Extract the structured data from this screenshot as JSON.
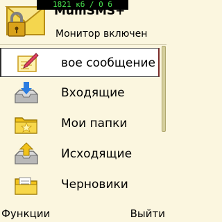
{
  "status_bar": {
    "memory_text": "1821 кб / 0 б"
  },
  "header": {
    "app_title": "MumSMS+",
    "status_text": "Монитор включен",
    "icon": "envelope-lock-icon"
  },
  "menu": {
    "items": [
      {
        "label": "Новое сообщение",
        "display_label": "вое сообщение",
        "icon": "new-message-icon",
        "selected": true
      },
      {
        "label": "Входящие",
        "icon": "inbox-tray-icon",
        "selected": false
      },
      {
        "label": "Мои папки",
        "icon": "folder-star-icon",
        "selected": false
      },
      {
        "label": "Исходящие",
        "icon": "outbox-tray-icon",
        "selected": false
      },
      {
        "label": "Черновики",
        "icon": "drafts-folder-icon",
        "selected": false
      }
    ]
  },
  "softkeys": {
    "left": "Функции",
    "right": "Выйти"
  },
  "colors": {
    "background": "#fbf6df",
    "status_text": "#49e34f",
    "selection_bg": "#ffffff"
  }
}
